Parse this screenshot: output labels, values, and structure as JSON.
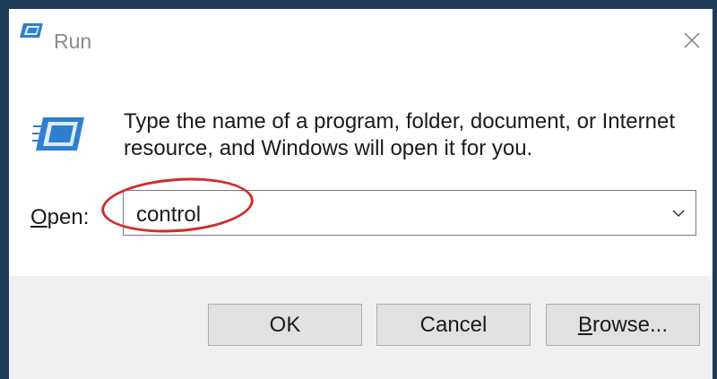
{
  "window": {
    "title": "Run",
    "title_icon": "run-icon",
    "close_icon": "close-icon"
  },
  "dialog": {
    "icon": "run-icon",
    "description": "Type the name of a program, folder, document, or Internet resource, and Windows will open it for you."
  },
  "open_field": {
    "label_accel": "O",
    "label_rest": "pen:",
    "value": "control",
    "dropdown_icon": "chevron-down-icon"
  },
  "annotation": {
    "highlight_color": "#d42a2a"
  },
  "buttons": {
    "ok": "OK",
    "cancel": "Cancel",
    "browse_accel": "B",
    "browse_rest": "rowse..."
  },
  "colors": {
    "window_border": "#1f3b5a",
    "footer_bg": "#f0f0f0",
    "button_bg": "#e1e1e1",
    "icon_blue": "#2f7fd0"
  }
}
